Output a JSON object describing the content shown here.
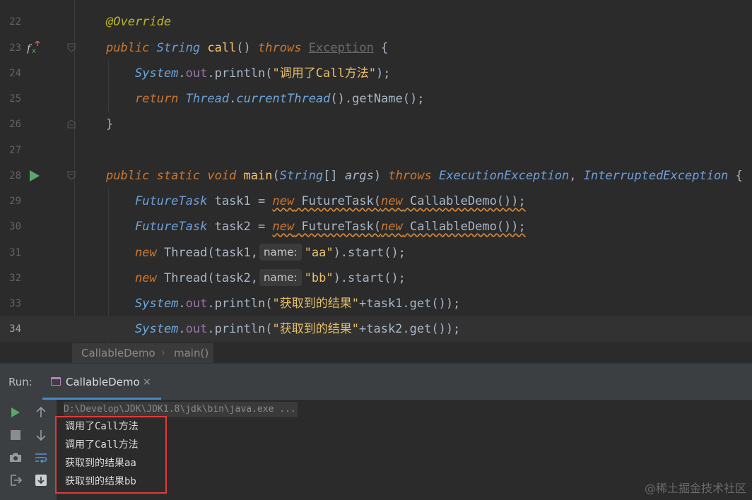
{
  "editor": {
    "lines": [
      {
        "num": "22"
      },
      {
        "num": "23"
      },
      {
        "num": "24"
      },
      {
        "num": "25"
      },
      {
        "num": "26"
      },
      {
        "num": "27"
      },
      {
        "num": "28"
      },
      {
        "num": "29"
      },
      {
        "num": "30"
      },
      {
        "num": "31"
      },
      {
        "num": "32"
      },
      {
        "num": "33"
      },
      {
        "num": "34"
      }
    ],
    "code": {
      "l22_annotation": "@Override",
      "l23_public": "public",
      "l23_string": "String",
      "l23_call": "call",
      "l23_paren": "() ",
      "l23_throws": "throws",
      "l23_exception": "Exception",
      "l23_brace": " {",
      "l24_system": "System",
      "l24_dot1": ".",
      "l24_out": "out",
      "l24_println": ".println(",
      "l24_str": "\"调用了Call方法\"",
      "l24_end": ");",
      "l25_return": "return",
      "l25_thread": "Thread",
      "l25_dot": ".",
      "l25_current": "currentThread",
      "l25_getname": "().getName();",
      "l26_brace": "}",
      "l28_public": "public",
      "l28_static": "static",
      "l28_void": "void",
      "l28_main": "main",
      "l28_lp": "(",
      "l28_string": "String",
      "l28_arr": "[] ",
      "l28_args": "args",
      "l28_rp": ") ",
      "l28_throws": "throws",
      "l28_ex1": "ExecutionException",
      "l28_comma": ", ",
      "l28_ex2": "InterruptedException",
      "l28_brace": " {",
      "l29_type": "FutureTask",
      "l29_var": " task1 = ",
      "l29_new": "new",
      "l29_ctor": " FutureTask(",
      "l29_new2": "new",
      "l29_demo": " CallableDemo());",
      "l30_type": "FutureTask",
      "l30_var": " task2 = ",
      "l30_new": "new",
      "l30_ctor": " FutureTask(",
      "l30_new2": "new",
      "l30_demo": " CallableDemo());",
      "l31_new": "new",
      "l31_thread": " Thread(task1,",
      "l31_hint": "name:",
      "l31_str": "\"aa\"",
      "l31_end": ").start();",
      "l32_new": "new",
      "l32_thread": " Thread(task2,",
      "l32_hint": "name:",
      "l32_str": "\"bb\"",
      "l32_end": ").start();",
      "l33_system": "System",
      "l33_dot": ".",
      "l33_out": "out",
      "l33_println": ".println(",
      "l33_str": "\"获取到的结果\"",
      "l33_end": "+task1.get());",
      "l34_system": "System",
      "l34_dot": ".",
      "l34_out": "out",
      "l34_println": ".println(",
      "l34_str": "\"获取到的结果\"",
      "l34_end": "+task2.get());"
    }
  },
  "breadcrumb": {
    "class_name": "CallableDemo",
    "separator": "›",
    "method_name": "main()"
  },
  "run_panel": {
    "label": "Run:",
    "tab_title": "CallableDemo",
    "tab_close": "×",
    "command_line": "D:\\Develop\\JDK\\JDK1.8\\jdk\\bin\\java.exe ...",
    "output_lines": [
      "调用了Call方法",
      "调用了Call方法",
      "获取到的结果aa",
      "获取到的结果bb"
    ]
  },
  "watermark": "@稀土掘金技术社区",
  "colors": {
    "background": "#2b2b2b",
    "keyword": "#cc7832",
    "string": "#e8bf6a",
    "highlight_box": "#e03a3a",
    "run_icon": "#59a869"
  }
}
